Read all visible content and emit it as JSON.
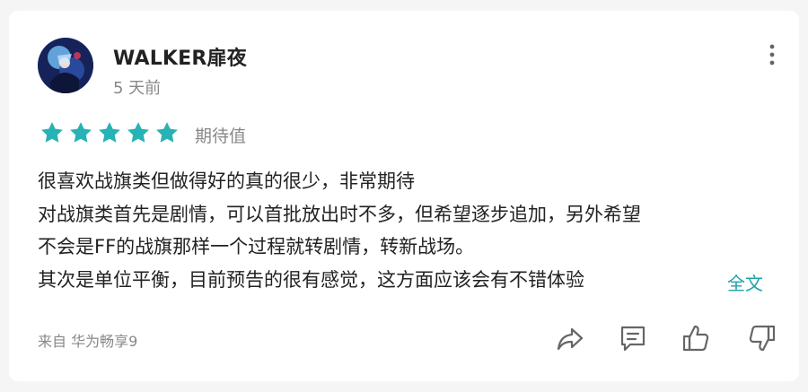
{
  "review": {
    "username": "WALKER扉夜",
    "time": "5 天前",
    "rating": 5,
    "rating_max": 5,
    "rating_label": "期待值",
    "lines": [
      "很喜欢战旗类但做得好的真的很少，非常期待",
      "对战旗类首先是剧情，可以首批放出时不多，但希望逐步追加，另外希望",
      "不会是FF的战旗那样一个过程就转剧情，转新战场。",
      "其次是单位平衡，目前预告的很有感觉，这方面应该会有不错体验"
    ],
    "expand_label": "全文",
    "source": "来自 华为畅享9"
  },
  "icons": {
    "avatar": "avatar",
    "more": "more-vertical-icon",
    "share": "share-icon",
    "comment": "comment-icon",
    "like": "thumbs-up-icon",
    "dislike": "thumbs-down-icon",
    "star": "star-icon"
  },
  "colors": {
    "star": "#27b2b5",
    "accent": "#1fa3a6",
    "muted_text": "#888888",
    "body_text": "#222222",
    "icon": "#666666"
  }
}
